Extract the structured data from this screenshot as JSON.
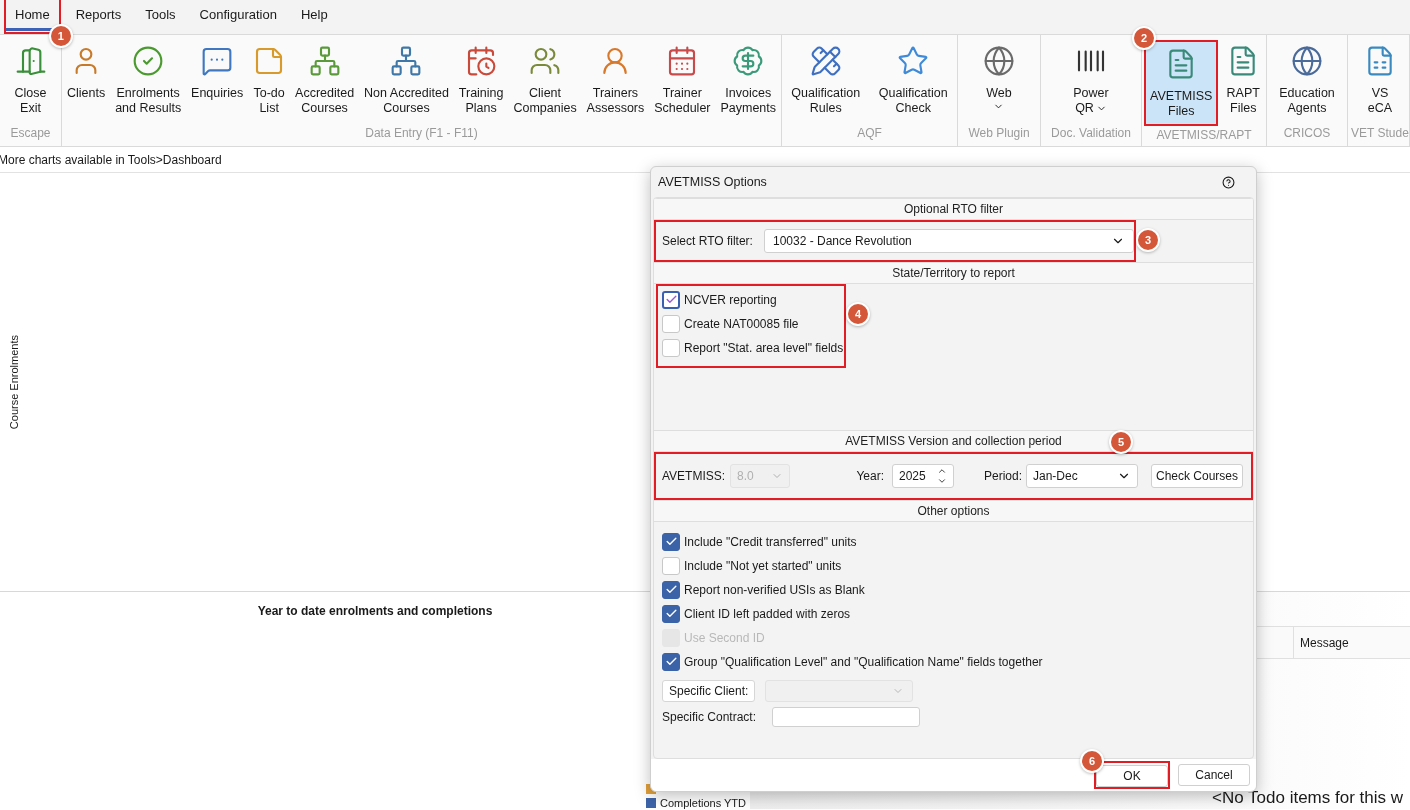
{
  "menu_tabs": [
    {
      "label": "Home",
      "selected": true,
      "callout": "1"
    },
    {
      "label": "Reports",
      "selected": false
    },
    {
      "label": "Tools",
      "selected": false
    },
    {
      "label": "Configuration",
      "selected": false
    },
    {
      "label": "Help",
      "selected": false
    }
  ],
  "ribbon_groups": [
    {
      "label": "Escape",
      "items": [
        {
          "lines": [
            "Close",
            "Exit"
          ]
        }
      ]
    },
    {
      "label": "Data Entry (F1 - F11)",
      "items": [
        {
          "lines": [
            "Clients"
          ]
        },
        {
          "lines": [
            "Enrolments",
            "and Results"
          ]
        },
        {
          "lines": [
            "Enquiries"
          ]
        },
        {
          "lines": [
            "To-do",
            "List"
          ]
        },
        {
          "lines": [
            "Accredited",
            "Courses"
          ]
        },
        {
          "lines": [
            "Non Accredited",
            "Courses"
          ]
        },
        {
          "lines": [
            "Training",
            "Plans"
          ]
        },
        {
          "lines": [
            "Client",
            "Companies"
          ]
        },
        {
          "lines": [
            "Trainers",
            "Assessors"
          ]
        },
        {
          "lines": [
            "Trainer",
            "Scheduler"
          ]
        },
        {
          "lines": [
            "Invoices",
            "Payments"
          ]
        }
      ]
    },
    {
      "label": "AQF",
      "items": [
        {
          "lines": [
            "Qualification",
            "Rules"
          ]
        },
        {
          "lines": [
            "Qualification",
            "Check"
          ]
        }
      ]
    },
    {
      "label": "Web Plugin",
      "items": [
        {
          "lines": [
            "Web"
          ],
          "dropdown": true
        }
      ]
    },
    {
      "label": "Doc. Validation",
      "items": [
        {
          "lines": [
            "Power",
            "QR"
          ],
          "dropdown": true
        }
      ]
    },
    {
      "label": "AVETMISS/RAPT",
      "items": [
        {
          "lines": [
            "AVETMISS",
            "Files"
          ],
          "selected": true,
          "callout": "2"
        },
        {
          "lines": [
            "RAPT",
            "Files"
          ],
          "selected": false
        }
      ]
    },
    {
      "label": "CRICOS",
      "items": [
        {
          "lines": [
            "Education",
            "Agents"
          ]
        }
      ]
    },
    {
      "label": "VET Stude",
      "items": [
        {
          "lines": [
            "VS",
            "eCA"
          ]
        }
      ]
    }
  ],
  "charts_note": "More charts available in Tools>Dashboard",
  "upper_chart": {
    "ylabel": "Course Enrolments"
  },
  "lower_chart": {
    "title": "Year to date enrolments and completions",
    "legend": [
      {
        "color": "#e0a03a"
      },
      {
        "label": "Completions YTD",
        "color": "#3d63a8"
      }
    ]
  },
  "todo": {
    "columns": [
      "",
      "Message"
    ],
    "empty_text": "<No Todo items for this w"
  },
  "dialog": {
    "title": "AVETMISS Options",
    "rto_section": {
      "heading": "Optional RTO filter",
      "label": "Select RTO filter:",
      "value": "10032 - Dance Revolution",
      "callout": "3"
    },
    "state_section": {
      "heading": "State/Territory to report",
      "callout": "4",
      "options": [
        {
          "label": "NCVER reporting",
          "checked": true
        },
        {
          "label": "Create NAT00085 file",
          "checked": false
        },
        {
          "label": "Report \"Stat. area level\" fields",
          "checked": false
        }
      ]
    },
    "version_section": {
      "heading": "AVETMISS Version and collection period",
      "callout": "5",
      "avetmiss_label": "AVETMISS:",
      "avetmiss_value": "8.0",
      "avetmiss_disabled": true,
      "year_label": "Year:",
      "year_value": "2025",
      "period_label": "Period:",
      "period_value": "Jan-Dec",
      "check_button": "Check Courses"
    },
    "other_section": {
      "heading": "Other options",
      "options": [
        {
          "label": "Include \"Credit transferred\" units",
          "checked": true,
          "disabled": false
        },
        {
          "label": "Include \"Not yet started\" units",
          "checked": false,
          "disabled": false
        },
        {
          "label": "Report non-verified USIs as Blank",
          "checked": true,
          "disabled": false
        },
        {
          "label": "Client ID left padded with zeros",
          "checked": true,
          "disabled": false
        },
        {
          "label": "Use Second ID",
          "checked": false,
          "disabled": true
        },
        {
          "label": "Group \"Qualification Level\" and \"Qualification Name\" fields together",
          "checked": true,
          "disabled": false
        }
      ],
      "client_button": "Specific Client:",
      "client_disabled": true,
      "contract_label": "Specific Contract:"
    },
    "buttons": [
      {
        "label": "OK",
        "callout": "6"
      },
      {
        "label": "Cancel"
      }
    ]
  }
}
